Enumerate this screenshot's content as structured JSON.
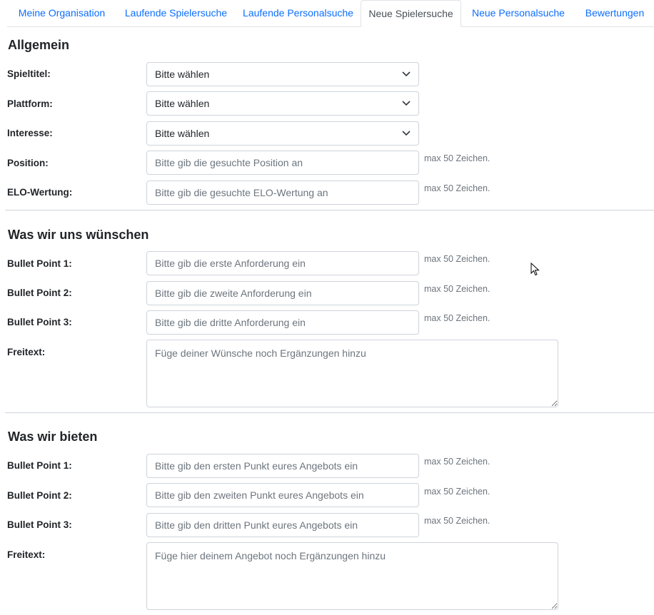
{
  "tabs": [
    {
      "label": "Meine Organisation"
    },
    {
      "label": "Laufende Spielersuche"
    },
    {
      "label": "Laufende Personalsuche"
    },
    {
      "label": "Neue Spielersuche",
      "active": true
    },
    {
      "label": "Neue Personalsuche"
    },
    {
      "label": "Bewertungen"
    }
  ],
  "general": {
    "heading": "Allgemein",
    "game_title": {
      "label": "Spieltitel:",
      "value": "Bitte wählen"
    },
    "platform": {
      "label": "Plattform:",
      "value": "Bitte wählen"
    },
    "interest": {
      "label": "Interesse:",
      "value": "Bitte wählen"
    },
    "position": {
      "label": "Position:",
      "placeholder": "Bitte gib die gesuchte Position an",
      "hint": "max 50 Zeichen."
    },
    "elo": {
      "label": "ELO-Wertung:",
      "placeholder": "Bitte gib die gesuchte ELO-Wertung an",
      "hint": "max 50 Zeichen."
    }
  },
  "wishes": {
    "heading": "Was wir uns wünschen",
    "bullet1": {
      "label": "Bullet Point 1:",
      "placeholder": "Bitte gib die erste Anforderung ein",
      "hint": "max 50 Zeichen."
    },
    "bullet2": {
      "label": "Bullet Point 2:",
      "placeholder": "Bitte gib die zweite Anforderung ein",
      "hint": "max 50 Zeichen."
    },
    "bullet3": {
      "label": "Bullet Point 3:",
      "placeholder": "Bitte gib die dritte Anforderung ein",
      "hint": "max 50 Zeichen."
    },
    "freetext": {
      "label": "Freitext:",
      "placeholder": "Füge deiner Wünsche noch Ergänzungen hinzu"
    }
  },
  "offer": {
    "heading": "Was wir bieten",
    "bullet1": {
      "label": "Bullet Point 1:",
      "placeholder": "Bitte gib den ersten Punkt eures Angebots ein",
      "hint": "max 50 Zeichen."
    },
    "bullet2": {
      "label": "Bullet Point 2:",
      "placeholder": "Bitte gib den zweiten Punkt eures Angebots ein",
      "hint": "max 50 Zeichen."
    },
    "bullet3": {
      "label": "Bullet Point 3:",
      "placeholder": "Bitte gib den dritten Punkt eures Angebots ein",
      "hint": "max 50 Zeichen."
    },
    "freetext": {
      "label": "Freitext:",
      "placeholder": "Füge hier deinem Angebot noch Ergänzungen hinzu"
    }
  },
  "colors": {
    "link": "#0d6efd",
    "border": "#ced4da",
    "muted": "#6c757d"
  },
  "icons": {
    "select_indicator": "chevron-down-icon",
    "pointer": "mouse-cursor-icon"
  }
}
